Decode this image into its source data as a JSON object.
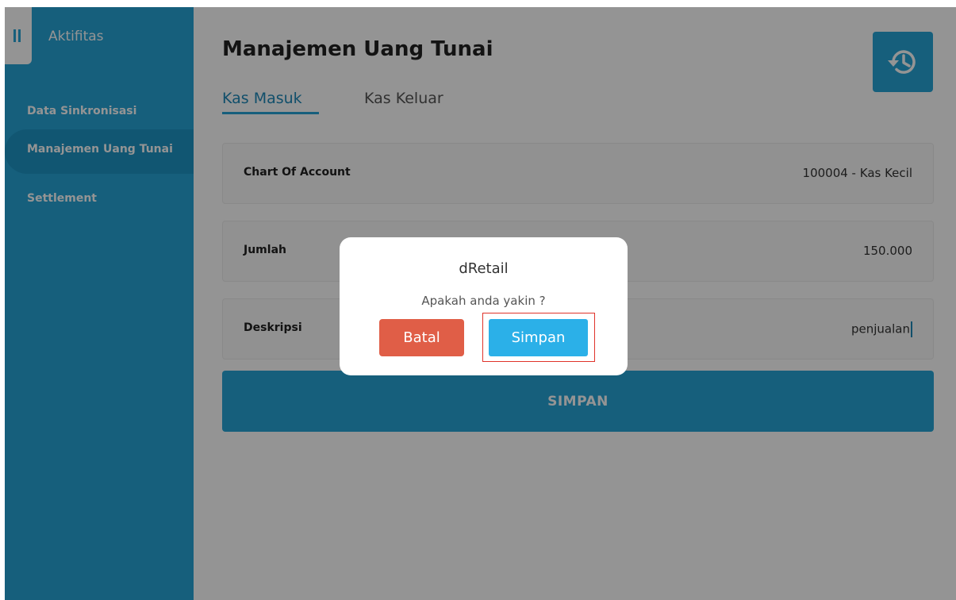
{
  "sidebar": {
    "title": "Aktifitas",
    "items": [
      {
        "label": "Data Sinkronisasi"
      },
      {
        "label": "Manajemen Uang Tunai"
      },
      {
        "label": "Settlement"
      }
    ]
  },
  "main": {
    "title": "Manajemen Uang Tunai",
    "tabs": [
      {
        "label": "Kas Masuk"
      },
      {
        "label": "Kas Keluar"
      }
    ],
    "fields": [
      {
        "label": "Chart Of Account",
        "value": "100004 - Kas Kecil"
      },
      {
        "label": "Jumlah",
        "value": "150.000"
      },
      {
        "label": "Deskripsi",
        "value": "penjualan"
      }
    ],
    "submit_label": "SIMPAN",
    "history_icon": "history-icon"
  },
  "dialog": {
    "title": "dRetail",
    "message": "Apakah anda yakin ?",
    "cancel_label": "Batal",
    "confirm_label": "Simpan"
  },
  "colors": {
    "primary": "#27a4d6",
    "danger": "#e05e47",
    "highlight": "#e0332b"
  }
}
